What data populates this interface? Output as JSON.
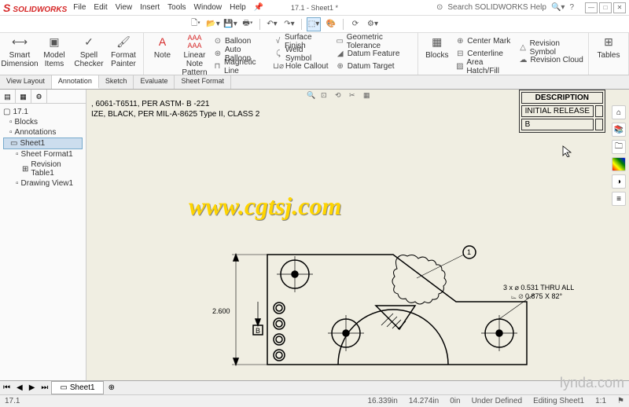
{
  "app": {
    "name": "SOLIDWORKS",
    "title": "17.1 - Sheet1 *",
    "search": "Search SOLIDWORKS Help"
  },
  "menu": [
    "File",
    "Edit",
    "View",
    "Insert",
    "Tools",
    "Window",
    "Help"
  ],
  "ribbon": {
    "big": [
      "Smart Dimension",
      "Model Items",
      "Spell Checker",
      "Format Painter",
      "Note",
      "Linear Note Pattern",
      "Blocks",
      "Tables"
    ],
    "col1": [
      "Balloon",
      "Auto Balloon",
      "Magnetic Line"
    ],
    "col2": [
      "Surface Finish",
      "Weld Symbol",
      "Hole Callout"
    ],
    "col3": [
      "Geometric Tolerance",
      "Datum Feature",
      "Datum Target"
    ],
    "col4": [
      "Center Mark",
      "Centerline",
      "Area Hatch/Fill"
    ],
    "col5": [
      "Revision Symbol",
      "Revision Cloud"
    ]
  },
  "tabs": [
    "View Layout",
    "Annotation",
    "Sketch",
    "Evaluate",
    "Sheet Format"
  ],
  "tree": {
    "root": "17.1",
    "items": [
      "Blocks",
      "Annotations",
      "Sheet1",
      "Sheet Format1",
      "Revision Table1",
      "Drawing View1"
    ]
  },
  "notes": {
    "line1": ", 6061-T6511, PER ASTM- B -221",
    "line2": "IZE, BLACK, PER MIL-A-8625 Type II, CLASS 2"
  },
  "revtable": {
    "h1": "DESCRIPTION",
    "r1": "INITIAL RELEASE",
    "c1": "B"
  },
  "dims": {
    "h": "2.600",
    "datum": "B",
    "callout1": "3 x ⌀ 0.531 THRU ALL",
    "callout2": "⌳ ⌀ 0.875 X 82°",
    "balloon": "1"
  },
  "watermark": "www.cgtsj.com",
  "sheet": "Sheet1",
  "status": {
    "doc": "17.1",
    "x": "16.339in",
    "y": "14.274in",
    "z": "0in",
    "state": "Under Defined",
    "mode": "Editing Sheet1",
    "scale": "1:1"
  },
  "brand": "lynda.com"
}
